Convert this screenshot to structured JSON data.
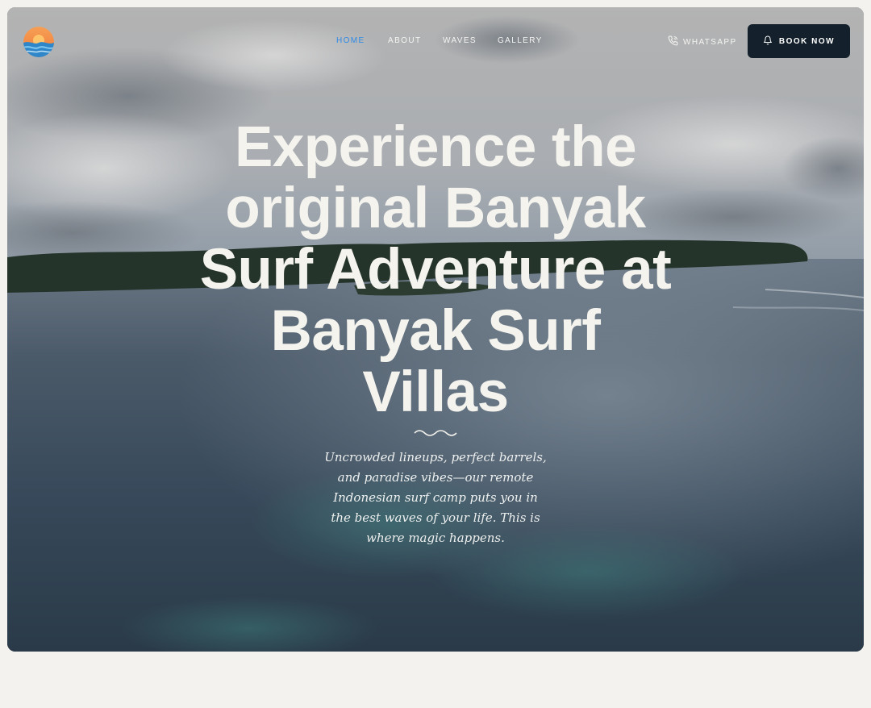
{
  "brand": {
    "logo_icon": "sunset-wave-logo-icon"
  },
  "nav": {
    "links": [
      {
        "label": "HOME",
        "active": true
      },
      {
        "label": "ABOUT",
        "active": false
      },
      {
        "label": "WAVES",
        "active": false
      },
      {
        "label": "GALLERY",
        "active": false
      }
    ],
    "active_color": "#2f8ae6"
  },
  "actions": {
    "whatsapp_label": "WHATSAPP",
    "whatsapp_icon": "phone-icon",
    "book_label": "BOOK NOW",
    "book_icon": "bell-icon",
    "book_bg": "#14202b"
  },
  "hero": {
    "headline": "Experience the original Banyak Surf Adventure at Banyak Surf Villas",
    "divider_icon": "wave-divider-icon",
    "subtitle": "Uncrowded lineups, perfect barrels, and paradise vibes—our remote Indonesian surf camp puts you in the best waves of your life. This is where magic happens."
  }
}
